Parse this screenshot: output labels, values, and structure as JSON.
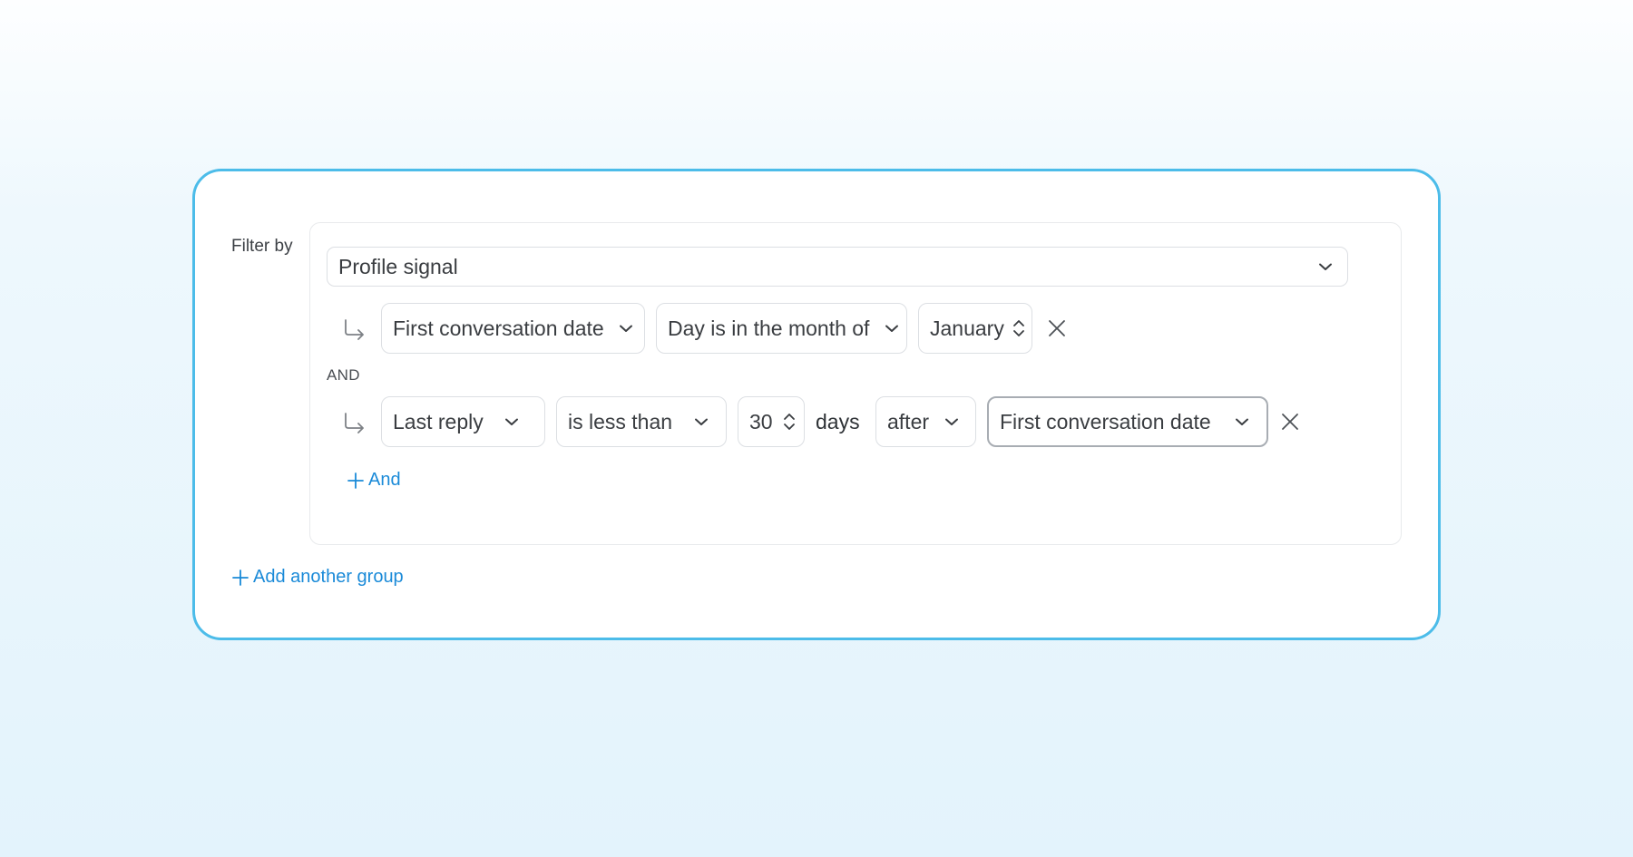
{
  "filter": {
    "label": "Filter by",
    "group_select": "Profile signal",
    "rows": [
      {
        "field": "First conversation date",
        "operator": "Day is in the month of",
        "value": "January"
      },
      {
        "field": "Last reply",
        "operator": "is less than",
        "value": "30",
        "unit": "days",
        "relation": "after",
        "reference": "First conversation date"
      }
    ],
    "connector": "AND",
    "add_and_label": "And",
    "add_group_label": "Add another group"
  },
  "icons": {
    "subrow": "subdirectory-arrow-icon",
    "dropdown": "chevron-down-icon",
    "stepper": "up-down-chevron-icon",
    "remove": "close-icon",
    "add": "plus-icon"
  },
  "colors": {
    "card_border": "#4cbce9",
    "link": "#1a8ad8",
    "control_border": "#dcdfe3"
  }
}
